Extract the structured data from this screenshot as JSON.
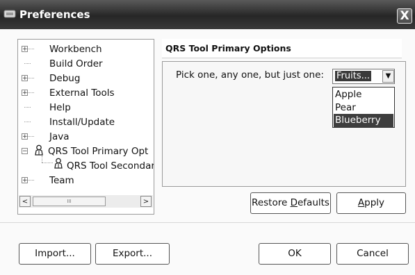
{
  "window": {
    "title": "Preferences",
    "close_label": "X"
  },
  "tree": {
    "items": [
      {
        "label": "Workbench",
        "expandable": true
      },
      {
        "label": "Build Order",
        "expandable": false
      },
      {
        "label": "Debug",
        "expandable": true
      },
      {
        "label": "External Tools",
        "expandable": true
      },
      {
        "label": "Help",
        "expandable": false
      },
      {
        "label": "Install/Update",
        "expandable": false
      },
      {
        "label": "Java",
        "expandable": true
      },
      {
        "label": "QRS Tool Primary Opt",
        "expandable": true,
        "expanded": true,
        "icon": "person-icon"
      },
      {
        "label": "QRS Tool Secondar",
        "expandable": false,
        "icon": "person-icon"
      },
      {
        "label": "Team",
        "expandable": true
      }
    ],
    "expand_symbol": "+",
    "collapse_symbol": "−",
    "scroll_left": "<",
    "scroll_right": ">",
    "scroll_thumb_grip": "III"
  },
  "page": {
    "title": "QRS Tool Primary Options",
    "pick_label": "Pick one, any one, but just one:",
    "combo_value": "Fruits...",
    "combo_arrow": "▼",
    "options": [
      "Apple",
      "Pear",
      "Blueberry"
    ],
    "highlighted_option": "Blueberry"
  },
  "buttons": {
    "restore_defaults_pre": "Restore ",
    "restore_defaults_u": "D",
    "restore_defaults_post": "efaults",
    "apply_pre": "",
    "apply_u": "A",
    "apply_post": "pply",
    "import": "Import...",
    "export": "Export...",
    "ok": "OK",
    "cancel": "Cancel"
  }
}
